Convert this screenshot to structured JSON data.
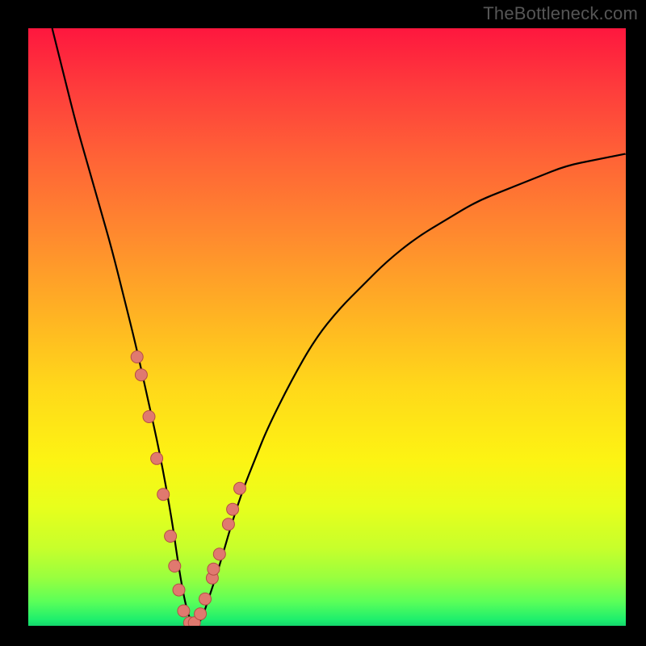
{
  "watermark": "TheBottleneck.com",
  "chart_data": {
    "type": "line",
    "title": "",
    "xlabel": "",
    "ylabel": "",
    "xlim": [
      0,
      100
    ],
    "ylim": [
      0,
      100
    ],
    "grid": false,
    "curve_note": "V-shaped bottleneck curve reaching 0 near x≈27; left branch steep, right branch gradual asymptote",
    "curve": {
      "x": [
        4,
        6,
        8,
        10,
        12,
        14,
        16,
        18,
        20,
        22,
        24,
        25,
        26,
        27,
        28,
        29,
        30,
        32,
        34,
        36,
        38,
        40,
        44,
        48,
        52,
        56,
        60,
        65,
        70,
        75,
        80,
        85,
        90,
        95,
        100
      ],
      "y": [
        100,
        92,
        84,
        77,
        70,
        63,
        55,
        47,
        38,
        29,
        18,
        11,
        5,
        1,
        0,
        1,
        4,
        10,
        17,
        23,
        28,
        33,
        41,
        48,
        53,
        57,
        61,
        65,
        68,
        71,
        73,
        75,
        77,
        78,
        79
      ]
    },
    "markers_note": "salmon circular markers clustered near the trough on both branches",
    "markers": {
      "x": [
        18.2,
        18.9,
        20.2,
        21.5,
        22.6,
        23.8,
        24.5,
        25.2,
        26.0,
        27.0,
        27.8,
        28.8,
        29.6,
        30.8,
        31.0,
        32.0,
        33.5,
        34.2,
        35.4
      ],
      "y": [
        45,
        42,
        35,
        28,
        22,
        15,
        10,
        6,
        2.5,
        0.5,
        0.5,
        2,
        4.5,
        8,
        9.5,
        12,
        17,
        19.5,
        23
      ]
    },
    "colors": {
      "curve": "#000000",
      "marker_fill": "#e0796f",
      "marker_stroke": "#b44e45",
      "gradient_top": "#fe173e",
      "gradient_bottom": "#14d66c"
    }
  }
}
